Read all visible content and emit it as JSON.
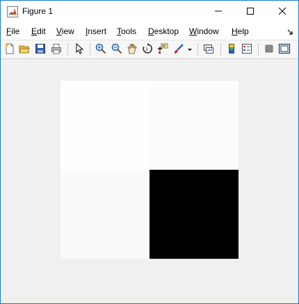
{
  "window": {
    "title": "Figure 1",
    "controls": {
      "minimize": "minimize-icon",
      "maximize": "maximize-icon",
      "close": "close-icon"
    }
  },
  "menu": {
    "items": [
      {
        "key": "F",
        "rest": "ile"
      },
      {
        "key": "E",
        "rest": "dit"
      },
      {
        "key": "V",
        "rest": "iew"
      },
      {
        "key": "I",
        "rest": "nsert"
      },
      {
        "key": "T",
        "rest": "ools"
      },
      {
        "key": "D",
        "rest": "esktop"
      },
      {
        "key": "W",
        "rest": "indow"
      },
      {
        "key": "H",
        "rest": "elp"
      }
    ]
  },
  "toolbar": {
    "buttons": [
      "new-figure-icon",
      "open-file-icon",
      "save-icon",
      "print-icon",
      "edit-plot-arrow-icon",
      "zoom-in-icon",
      "zoom-out-icon",
      "pan-hand-icon",
      "rotate-3d-icon",
      "data-cursor-icon",
      "brush-icon",
      "brush-dropdown-icon",
      "link-plot-icon",
      "insert-colorbar-icon",
      "insert-legend-icon",
      "hide-plot-tools-icon",
      "show-plot-tools-icon"
    ]
  },
  "image": {
    "grid": [
      [
        "#fefefe",
        "#fcfcfc"
      ],
      [
        "#fafafa",
        "#000000"
      ]
    ]
  },
  "colors": {
    "window_border": "#1979ca",
    "canvas_background": "#f0f0f0",
    "title_background": "#ffffff"
  }
}
